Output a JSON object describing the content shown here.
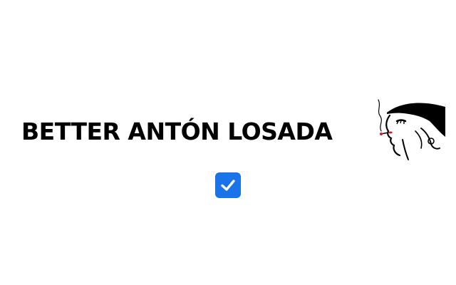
{
  "title": {
    "text": "BETTER ANTÓN LOSADA"
  },
  "logo": {
    "icon": "woman-with-hat-smoking-icon"
  },
  "checkbox": {
    "checked": true,
    "accent_color": "#1a73e8",
    "icon": "checkmark-icon"
  }
}
